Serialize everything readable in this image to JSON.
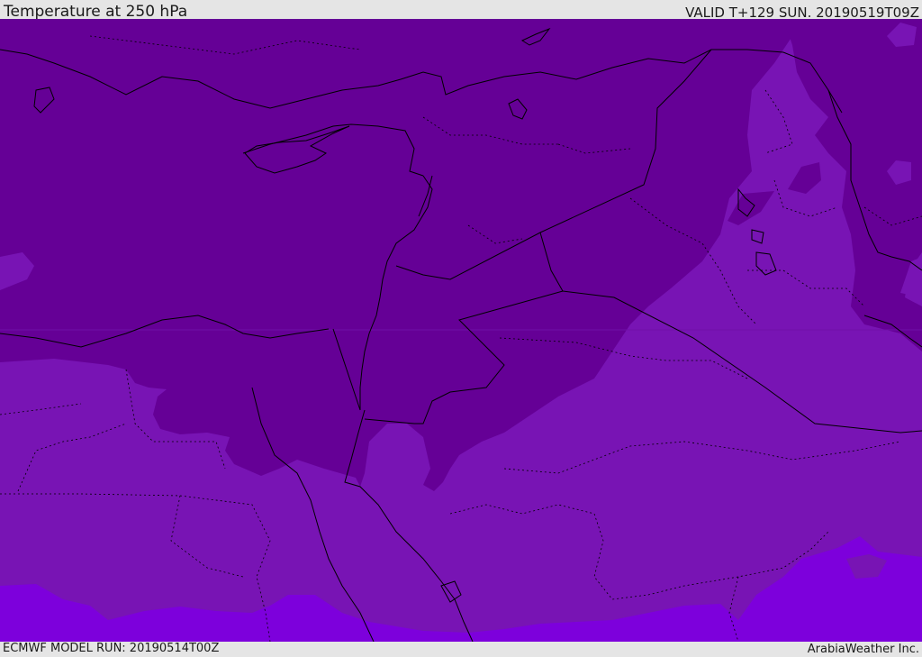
{
  "header": {
    "title": "Temperature at 250 hPa",
    "valid_time": "VALID T+129 SUN. 20190519T09Z"
  },
  "footer": {
    "model_run": "ECMWF MODEL RUN: 20190514T00Z",
    "credit": "ArabiaWeather Inc."
  },
  "map": {
    "colors": {
      "coldest_band": "#650096",
      "cold_band": "#7814b4",
      "warmer_band": "#7d00dc",
      "coastline": "#000000",
      "border": "#000000"
    }
  }
}
